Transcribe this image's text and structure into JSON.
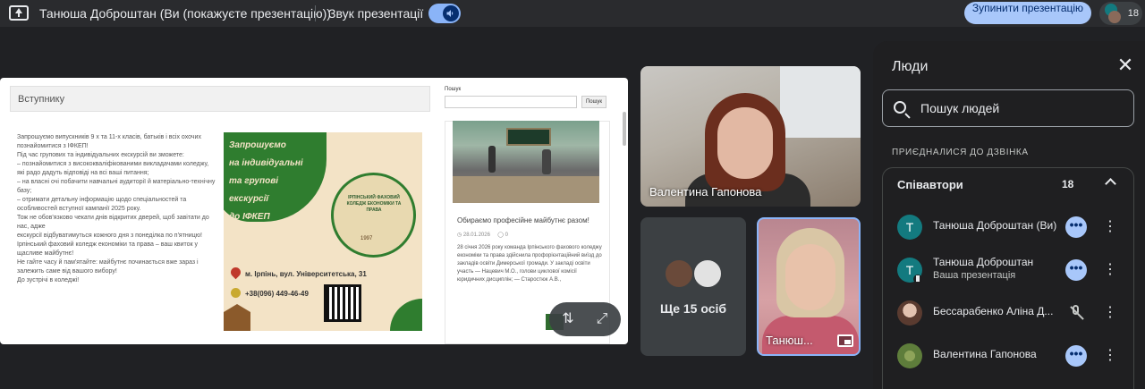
{
  "topbar": {
    "presenter_title": "Танюша Доброштан (Ви (покажуєте презентацію))",
    "sound_label": "Звук презентації",
    "stop_label": "Зупинити презентацію",
    "participants_count": "18"
  },
  "slide": {
    "header": "Вступнику",
    "text_lines": [
      "Запрошуємо випускників 9 х та 11-х класів, батьків і всіх охочих познайомитися з ІФКЕП!",
      "Під час групових та індивідуальних екскурсій ви зможете:",
      "– познайомитися з висококваліфікованими викладачами коледжу, які радо дадуть відповіді на всі ваші питання;",
      "– на власні очі побачити навчальні аудиторії й матеріально-технічну базу;",
      "– отримати детальну інформацію щодо спеціальностей та особливостей вступної кампанії 2025 року.",
      "Тож не обов'язково чекати днів відкритих дверей, щоб завітати до нас, адже",
      "екскурсії відбуватимуться кожного дня з понеділка по п'ятницю!",
      "Ірпінський фаховий коледж економіки та права – ваш квиток у щасливе майбутнє!",
      "Не гайте часу й пам'ятайте: майбутнє починається вже зараз і залежить саме від вашого вибору!",
      "До зустрічі в коледжі!"
    ],
    "poster": {
      "headline_lines": [
        "Запрошуємо",
        "на індивідуальні",
        "та групові екскурсії",
        "до ІФКЕП"
      ],
      "emblem_text": "ІРПІНСЬКИЙ ФАХОВИЙ КОЛЕДЖ ЕКОНОМІКИ ТА ПРАВА",
      "emblem_year": "1997",
      "address": "м. Ірпінь, вул. Університетська, 31",
      "phone": "+38(096) 449-46-49"
    },
    "search_label": "Пошук",
    "search_button": "Пошук",
    "news": {
      "title": "Обираємо професійне майбутнє разом!",
      "date": "28.01.2026",
      "comments": "0",
      "body": "28 січня 2026 року команда Ірпінського фахового коледжу економіки та права здійснила профорієнтаційний виїзд до закладів освіти Димерської громади. У закладі освіти участь — Нацевич М.О., голови циклової комісії юридичних дисциплін; — Старостюк А.В.,"
    }
  },
  "tiles": {
    "main_name": "Валентина Гапонова",
    "more_label": "Ще 15 осіб",
    "self_name": "Танюш..."
  },
  "panel": {
    "title": "Люди",
    "search_placeholder": "Пошук людей",
    "section_label": "ПРИЄДНАЛИСЯ ДО ДЗВІНКА",
    "group_name": "Співавтори",
    "group_count": "18",
    "people": [
      {
        "initial": "Т",
        "name": "Танюша Доброштан (Ви)",
        "sub": ""
      },
      {
        "initial": "Т",
        "name": "Танюша Доброштан",
        "sub": "Ваша презентація"
      },
      {
        "initial": "",
        "name": "Бессарабенко Аліна Д...",
        "sub": ""
      },
      {
        "initial": "",
        "name": "Валентина Гапонова",
        "sub": ""
      }
    ]
  },
  "colors": {
    "accent": "#a8c7fa",
    "avatar_teal": "#137a7f",
    "poster_green": "#2f7d2f"
  },
  "icons": [
    "present-screen-icon",
    "volume-icon",
    "close-icon",
    "search-icon",
    "chevron-up-icon",
    "more-options-icon",
    "kebab-icon",
    "mic-off-icon",
    "pin-icon",
    "pip-icon",
    "swap-icon",
    "expand-icon"
  ]
}
